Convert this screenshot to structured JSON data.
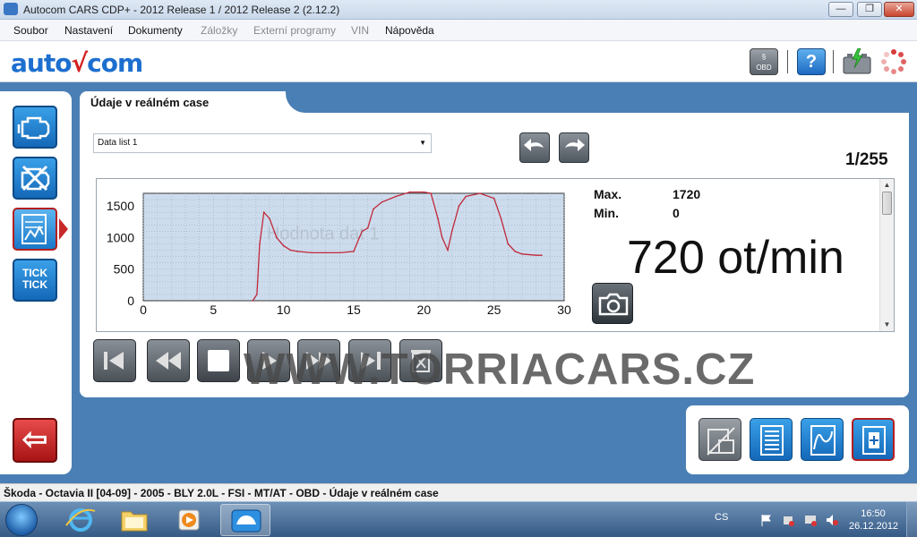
{
  "window": {
    "title": "Autocom CARS CDP+ - 2012 Release 1 / 2012 Release 2 (2.12.2)",
    "min_label": "—",
    "max_label": "❐",
    "close_label": "✕"
  },
  "menu": {
    "items": [
      {
        "label": "Soubor",
        "enabled": true
      },
      {
        "label": "Nastavení",
        "enabled": true
      },
      {
        "label": "Dokumenty",
        "enabled": true
      },
      {
        "label": "Záložky",
        "enabled": false
      },
      {
        "label": "Externí programy",
        "enabled": false
      },
      {
        "label": "VIN",
        "enabled": false
      },
      {
        "label": "Nápověda",
        "enabled": true
      }
    ]
  },
  "logo": {
    "part1": "auto",
    "part2": "com"
  },
  "topbar": {
    "obd_label": "§\nOBD",
    "help_label": "?"
  },
  "sidebar": {
    "tick_label": "TICK TICK",
    "back_label": "⇦"
  },
  "main": {
    "tab_title": "Údaje v reálném case",
    "datalist": {
      "selected": "Data list 1",
      "arrow": "▼"
    },
    "counter": "1/255",
    "stats": {
      "max_label": "Max.",
      "max_value": "1720",
      "min_label": "Min.",
      "min_value": "0"
    },
    "value_display": "720 ot/min",
    "watermark": "WWW.TORRIACARS.CZ"
  },
  "chart_data": {
    "type": "line",
    "title": "Hodnota dat 1",
    "xlabel": "",
    "ylabel": "",
    "xlim": [
      0,
      30
    ],
    "ylim": [
      0,
      1700
    ],
    "xticks": [
      0,
      5,
      10,
      15,
      20,
      25,
      30
    ],
    "yticks": [
      0,
      500,
      1000,
      1500
    ],
    "grid": true,
    "series": [
      {
        "name": "",
        "color": "#c0283a",
        "x": [
          7.8,
          8.1,
          8.3,
          8.6,
          9.0,
          9.5,
          10.0,
          10.5,
          11.0,
          12.0,
          13.0,
          14.0,
          15.0,
          15.4,
          15.6,
          16.0,
          16.4,
          17.0,
          18.0,
          19.0,
          20.0,
          20.5,
          21.0,
          21.3,
          21.7,
          22.0,
          22.5,
          23.0,
          24.0,
          25.0,
          25.5,
          26.0,
          26.5,
          27.0,
          28.0,
          28.4
        ],
        "y": [
          0,
          100,
          900,
          1400,
          1300,
          1000,
          870,
          800,
          780,
          760,
          760,
          760,
          780,
          1000,
          1100,
          1150,
          1450,
          1560,
          1650,
          1720,
          1720,
          1700,
          1300,
          1000,
          800,
          1100,
          1500,
          1650,
          1700,
          1620,
          1300,
          900,
          780,
          740,
          720,
          720
        ]
      }
    ]
  },
  "statusbar": {
    "text": "Škoda - Octavia II [04-09] - 2005 - BLY 2.0L - FSI - MT/AT - OBD - Údaje v reálném case"
  },
  "taskbar": {
    "language": "CS",
    "time": "16:50",
    "date": "26.12.2012"
  }
}
